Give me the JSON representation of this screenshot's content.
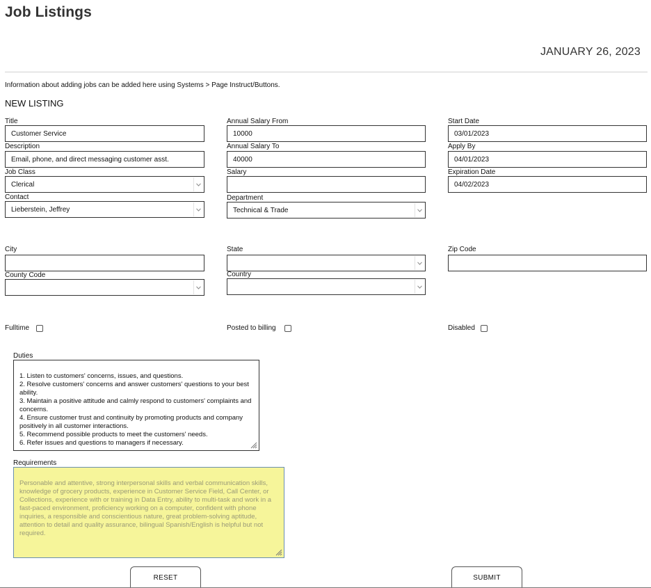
{
  "page": {
    "title": "Job Listings",
    "date": "JANUARY 26, 2023",
    "info": "Information about adding jobs can be added here using Systems > Page Instruct/Buttons.",
    "section_title": "NEW LISTING"
  },
  "form": {
    "title": {
      "label": "Title",
      "value": "Customer Service"
    },
    "description": {
      "label": "Description",
      "value": "Email, phone, and direct messaging customer asst."
    },
    "job_class": {
      "label": "Job Class",
      "value": "Clerical"
    },
    "contact": {
      "label": "Contact",
      "value": "Lieberstein, Jeffrey"
    },
    "salary_from": {
      "label": "Annual Salary From",
      "value": "10000"
    },
    "salary_to": {
      "label": "Annual Salary To",
      "value": "40000"
    },
    "salary": {
      "label": "Salary",
      "value": ""
    },
    "department": {
      "label": "Department",
      "value": "Technical & Trade"
    },
    "start_date": {
      "label": "Start Date",
      "value": "03/01/2023"
    },
    "apply_by": {
      "label": "Apply By",
      "value": "04/01/2023"
    },
    "expiration_date": {
      "label": "Expiration Date",
      "value": "04/02/2023"
    },
    "city": {
      "label": "City",
      "value": ""
    },
    "state": {
      "label": "State",
      "value": ""
    },
    "zip_code": {
      "label": "Zip Code",
      "value": ""
    },
    "county_code": {
      "label": "County Code",
      "value": ""
    },
    "country": {
      "label": "Country",
      "value": ""
    },
    "fulltime": {
      "label": "Fulltime",
      "checked": false
    },
    "posted_to_billing": {
      "label": "Posted to billing",
      "checked": false
    },
    "disabled": {
      "label": "Disabled",
      "checked": false
    },
    "duties": {
      "label": "Duties",
      "value": "1. Listen to customers' concerns, issues, and questions.\n2. Resolve customers' concerns and answer customers' questions to your best ability.\n3. Maintain a positive attitude and calmly respond to customers' complaints and concerns.\n4. Ensure customer trust and continuity by promoting products and company positively in all customer interactions.\n5. Recommend possible products to meet the customers' needs.\n6. Refer issues and questions to managers if necessary."
    },
    "requirements": {
      "label": "Requirements",
      "value": "Personable and attentive, strong interpersonal skills and verbal communication skills, knowledge of grocery products, experience in Customer Service Field, Call Center, or Collections, experience with or training in Data Entry, ability to multi-task and work in a fast-paced environment, proficiency working on a computer, confident with phone inquiries, a responsible and conscientious nature, great problem-solving aptitude, attention to detail and quality assurance, bilingual Spanish/English is helpful but not required."
    }
  },
  "buttons": {
    "reset": "RESET",
    "submit": "SUBMIT"
  },
  "colors": {
    "requirements_bg": "#f6f59a",
    "requirements_border": "#6a8fb0",
    "title_text": "#333333"
  },
  "icons": {
    "select": "chevron-down-icon",
    "resize": "resize-grip-icon"
  }
}
